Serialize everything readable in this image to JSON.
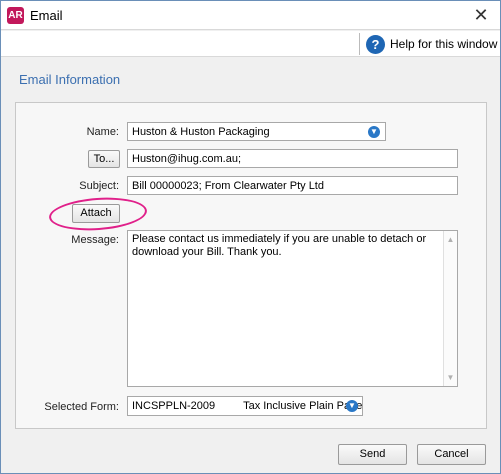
{
  "window": {
    "app_icon_text": "AR",
    "title": "Email",
    "close_glyph": "✕"
  },
  "help": {
    "icon_glyph": "?",
    "label": "Help for this window"
  },
  "section": {
    "title": "Email Information"
  },
  "form": {
    "name_label": "Name:",
    "name_value": "Huston & Huston Packaging",
    "to_button": "To...",
    "to_value": "Huston@ihug.com.au;",
    "subject_label": "Subject:",
    "subject_value": "Bill 00000023; From Clearwater Pty Ltd",
    "attach_button": "Attach",
    "message_label": "Message:",
    "message_value": "Please contact us immediately if you are unable to detach or download your Bill. Thank you.",
    "selected_form_label": "Selected Form:",
    "selected_form_value": "INCSPPLN-2009",
    "selected_form_desc": "Tax Inclusive Plain Paper"
  },
  "footer": {
    "send_button": "Send",
    "cancel_button": "Cancel"
  },
  "colors": {
    "highlight": "#e0208a",
    "accent": "#2a78c7",
    "section_title": "#3b6fb0"
  }
}
